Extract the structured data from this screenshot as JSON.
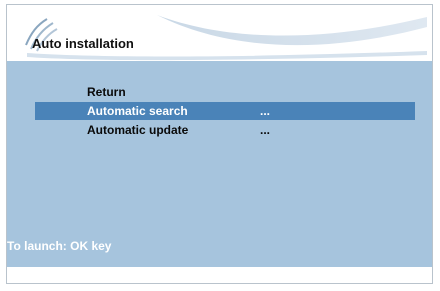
{
  "header": {
    "title": "Auto installation"
  },
  "menu": {
    "items": [
      {
        "label": "Return",
        "value": ""
      },
      {
        "label": "Automatic search",
        "value": "...",
        "selected": true
      },
      {
        "label": "Automatic update",
        "value": "..."
      }
    ]
  },
  "hint": {
    "text": "To launch: OK key"
  },
  "colors": {
    "panel": "#a6c4dd",
    "selection": "#4a83b8",
    "hint_text": "#ffffff"
  }
}
